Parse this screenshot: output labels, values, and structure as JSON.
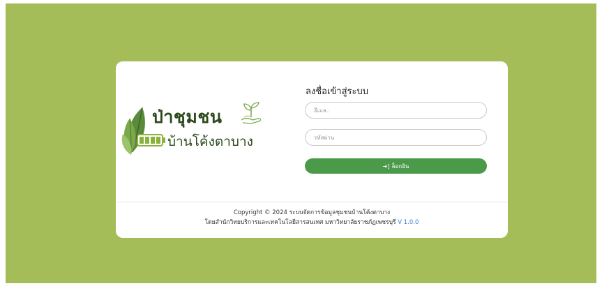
{
  "logo": {
    "title": "ป่าชุมชน",
    "subtitle": "บ้านโค้งตาบาง",
    "icons": [
      "leaves-icon",
      "battery-icon",
      "sprout-in-hand-icon"
    ]
  },
  "login_form": {
    "title": "ลงชื่อเข้าสู่ระบบ",
    "email_placeholder": "อีเมล..",
    "password_placeholder": "รหัสผ่าน",
    "submit_label": "ล็อกอิน",
    "submit_icon": "sign-in-icon"
  },
  "footer": {
    "copyright": "Copyright © 2024 ระบบจัดการข้อมูลชุมชนบ้านโค้งตาบาง",
    "credit": "โดยสำนักวิทยบริการและเทคโนโลยีสารสนเทศ มหาวิทยาลัยราชภัฏเพชรบุรี",
    "version": "V 1.0.0"
  },
  "colors": {
    "background": "#a4bd58",
    "card": "#ffffff",
    "button": "#4a9a4a",
    "version_link": "#3a7fd1",
    "logo_text": "#2c4a1c"
  }
}
